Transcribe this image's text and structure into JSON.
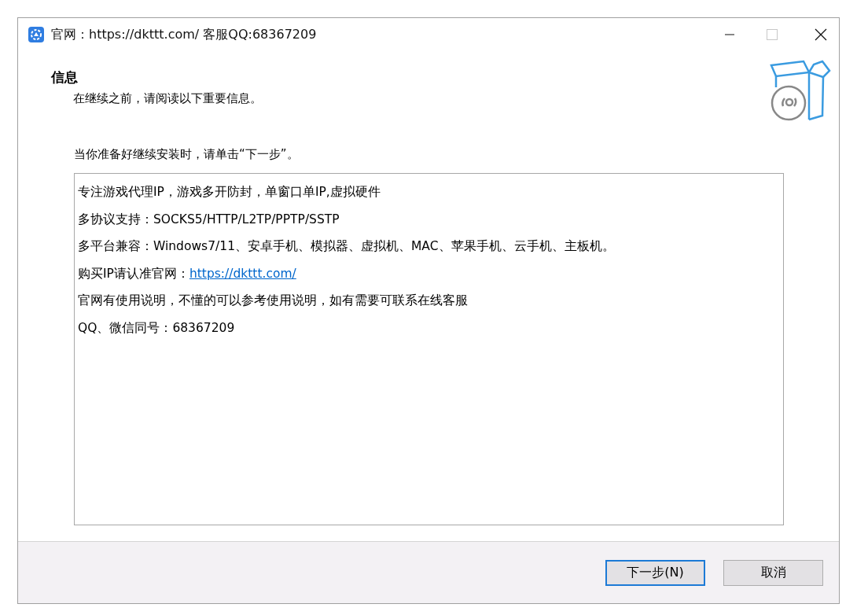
{
  "window": {
    "title": "官网：https://dkttt.com/ 客服QQ:68367209",
    "maximize_disabled": true
  },
  "header": {
    "title": "信息",
    "subtitle": "在继续之前，请阅读以下重要信息。"
  },
  "instruction": "当你准备好继续安装时，请单击“下一步”。",
  "memo": {
    "lines": [
      {
        "kind": "text",
        "text": "专注游戏代理IP，游戏多开防封，单窗口单IP,虚拟硬件"
      },
      {
        "kind": "text",
        "text": "多协议支持：SOCKS5/HTTP/L2TP/PPTP/SSTP"
      },
      {
        "kind": "text",
        "text": "多平台兼容：Windows7/11、安卓手机、模拟器、虚拟机、MAC、苹果手机、云手机、主板机。"
      },
      {
        "kind": "link",
        "text": "购买IP请认准官网：",
        "link": "https://dkttt.com/"
      },
      {
        "kind": "text",
        "text": "官网有使用说明，不懂的可以参考使用说明，如有需要可联系在线客服"
      },
      {
        "kind": "text",
        "text": "QQ、微信同号：68367209"
      }
    ]
  },
  "buttons": [
    {
      "label": "下一步(N)",
      "default": true
    },
    {
      "label": "取消",
      "default": false
    }
  ]
}
